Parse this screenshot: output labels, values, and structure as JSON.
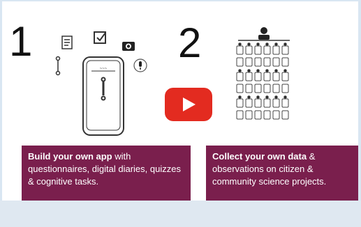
{
  "video": {
    "step1_number": "1",
    "step2_number": "2",
    "caption_left": {
      "bold": "Build your own app",
      "rest": " with questionnaires, digital diaries, quizzes & cognitive tasks."
    },
    "caption_right": {
      "bold": "Collect your own data",
      "rest": " & observations on citizen & community science projects."
    },
    "play_button_icon": "play-icon",
    "colors": {
      "caption_bg": "#7a1f4d",
      "play_red": "#e32b20",
      "frame_bg": "#ffffff",
      "page_bg": "#d9e6f2"
    }
  }
}
